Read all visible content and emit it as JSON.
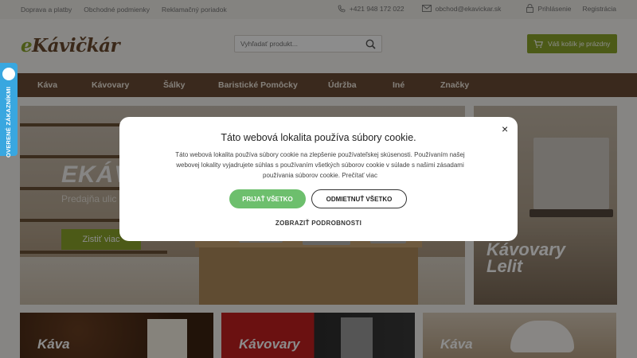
{
  "topbar": {
    "links": [
      "Doprava a platby",
      "Obchodné podmienky",
      "Reklamačný poriadok"
    ],
    "phone": "+421 948 172 022",
    "email": "obchod@ekavickar.sk",
    "login": "Prihlásenie",
    "register": "Registrácia"
  },
  "header": {
    "logo_prefix": "e",
    "logo_main": "Kávičkár",
    "search_placeholder": "Vyhľadať produkt...",
    "cart_label": "Váš košík je prázdny"
  },
  "nav": {
    "items": [
      "Káva",
      "Kávovary",
      "Šálky",
      "Baristické Pomôcky",
      "Údržba",
      "Iné",
      "Značky"
    ]
  },
  "hero": {
    "title": "EKÁV",
    "subtitle": "Predajňa ulic",
    "button": "Zistiť viac",
    "side_label_line1": "Kávovary",
    "side_label_line2": "Lelit"
  },
  "cards": [
    "Káva",
    "Kávovary",
    "Káva"
  ],
  "cookie": {
    "title": "Táto webová lokalita používa súbory cookie.",
    "body": "Táto webová lokalita používa súbory cookie na zlepšenie používateľskej skúsenosti. Používaním našej webovej lokality vyjadrujete súhlas s používaním všetkých súborov cookie v súlade s našimi zásadami používania súborov cookie. Prečítať viac",
    "accept": "PRIJAŤ VŠETKO",
    "reject": "ODMIETNUŤ VŠETKO",
    "details": "ZOBRAZIŤ PODROBNOSTI",
    "close": "×"
  },
  "reviews_tab": "OVERENÉ ZÁKAZNÍKMI",
  "colors": {
    "brand_green": "#8aa52a",
    "nav_brown": "#6b4b35",
    "accept_green": "#6dbf6d",
    "reviews_blue": "#39a7e0"
  }
}
